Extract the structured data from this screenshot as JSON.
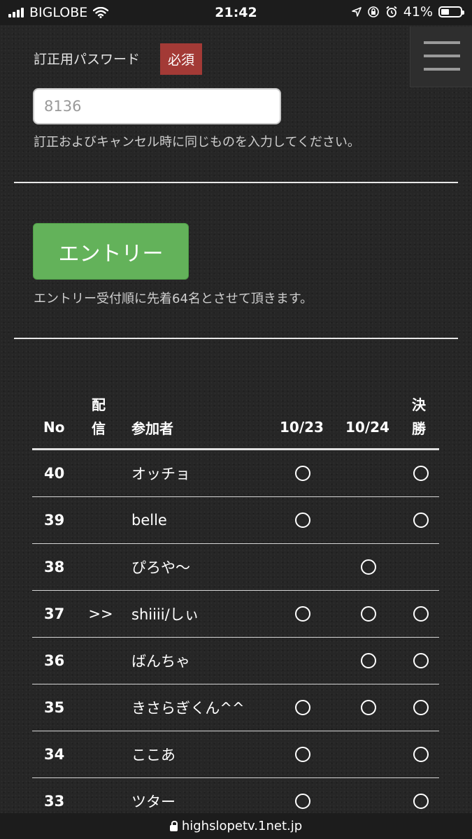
{
  "status_bar": {
    "carrier": "BIGLOBE",
    "time": "21:42",
    "battery_percent": "41%",
    "battery_level": 0.41
  },
  "form": {
    "password_label": "訂正用パスワード",
    "required_badge": "必須",
    "password_placeholder": "8136",
    "password_help": "訂正およびキャンセル時に同じものを入力してください。",
    "entry_button": "エントリー",
    "entry_help": "エントリー受付順に先着64名とさせて頂きます。"
  },
  "table": {
    "headers": {
      "no": "No",
      "stream_top": "配",
      "stream_bottom": "信",
      "participant": "参加者",
      "day1": "10/23",
      "day2": "10/24",
      "final_top": "決",
      "final_bottom": "勝"
    },
    "rows": [
      {
        "no": "40",
        "stream": "",
        "name": "オッチョ",
        "d1": true,
        "d2": false,
        "final": true
      },
      {
        "no": "39",
        "stream": "",
        "name": "belle",
        "d1": true,
        "d2": false,
        "final": true
      },
      {
        "no": "38",
        "stream": "",
        "name": "ぴろや〜",
        "d1": false,
        "d2": true,
        "final": false
      },
      {
        "no": "37",
        "stream": ">>",
        "name": "shiiii/しぃ",
        "d1": true,
        "d2": true,
        "final": true
      },
      {
        "no": "36",
        "stream": "",
        "name": "ばんちゃ",
        "d1": false,
        "d2": true,
        "final": true
      },
      {
        "no": "35",
        "stream": "",
        "name": "きさらぎくん^^",
        "d1": true,
        "d2": true,
        "final": true
      },
      {
        "no": "34",
        "stream": "",
        "name": "ここあ",
        "d1": true,
        "d2": false,
        "final": true
      },
      {
        "no": "33",
        "stream": "",
        "name": "ツター",
        "d1": true,
        "d2": false,
        "final": true
      }
    ]
  },
  "url_bar": {
    "domain": "highslopetv.1net.jp"
  }
}
